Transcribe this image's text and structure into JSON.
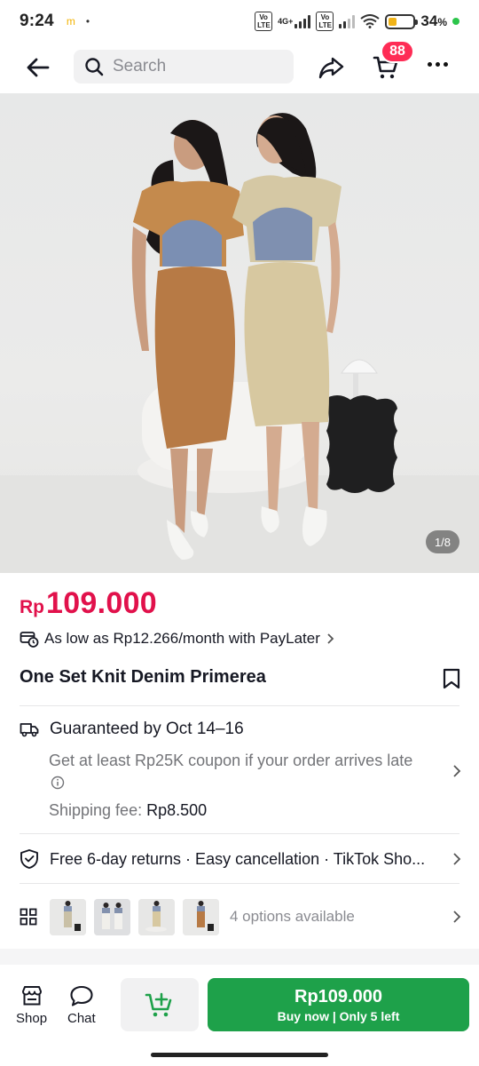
{
  "status_bar": {
    "time": "9:24",
    "network_label": "4G+",
    "battery_percent": "34",
    "battery_unit": "%"
  },
  "nav": {
    "search_placeholder": "Search",
    "cart_badge": "88"
  },
  "gallery": {
    "counter": "1/8"
  },
  "product": {
    "currency": "Rp",
    "price": "109.000",
    "paylater": "As low as Rp12.266/month with PayLater",
    "title": "One Set Knit Denim Primerea"
  },
  "shipping": {
    "guarantee": "Guaranteed by Oct 14–16",
    "coupon_note": "Get at least Rp25K coupon if your order arrives late",
    "fee_label": "Shipping fee:",
    "fee_value": "Rp8.500"
  },
  "returns": {
    "text": "Free 6-day returns · Easy cancellation · TikTok Sho..."
  },
  "options": {
    "label": "4 options available"
  },
  "bottom_bar": {
    "shop_label": "Shop",
    "chat_label": "Chat",
    "buy_price": "Rp109.000",
    "buy_sub": "Buy now | Only 5 left"
  },
  "colors": {
    "price_red": "#e1114b",
    "badge_red": "#fe2c55",
    "buy_green": "#1ea14a"
  },
  "icons": [
    "back-arrow-icon",
    "search-icon",
    "share-icon",
    "cart-icon",
    "more-icon",
    "paylater-icon",
    "bookmark-icon",
    "truck-icon",
    "info-icon",
    "shield-icon",
    "grid-icon",
    "chevron-right-icon",
    "shop-icon",
    "chat-icon",
    "add-to-cart-icon"
  ]
}
